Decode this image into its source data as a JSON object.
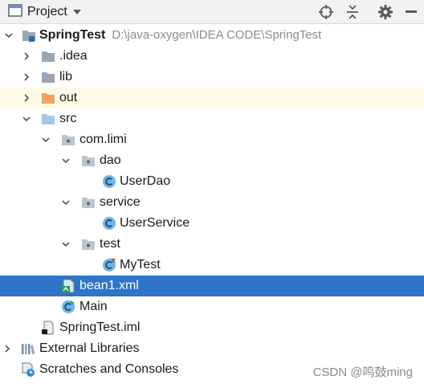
{
  "header": {
    "title": "Project",
    "icons": [
      "project-view-icon",
      "dropdown-arrow-icon",
      "locate-icon",
      "collapse-all-icon",
      "settings-gear-icon",
      "hide-panel-icon"
    ]
  },
  "tree": {
    "project": {
      "name": "SpringTest",
      "path": "D:\\java-oxygen\\IDEA CODE\\SpringTest"
    },
    "idea": ".idea",
    "lib": "lib",
    "out": "out",
    "src": "src",
    "package": "com.limi",
    "dao": "dao",
    "user_dao": "UserDao",
    "service": "service",
    "user_service": "UserService",
    "test": "test",
    "my_test": "MyTest",
    "bean1": "bean1.xml",
    "main": "Main",
    "iml": "SpringTest.iml",
    "external_libraries": "External Libraries",
    "scratches": "Scratches and Consoles"
  },
  "colors": {
    "selection": "#2f74c8",
    "highlight_row": "#fdfbe8",
    "folder_blue": "#a9c8e8",
    "folder_gray": "#9aa7b3",
    "folder_orange": "#f0a35e",
    "class_icon": "#2b8dd6"
  },
  "watermark": "CSDN @鸣鼓ming"
}
